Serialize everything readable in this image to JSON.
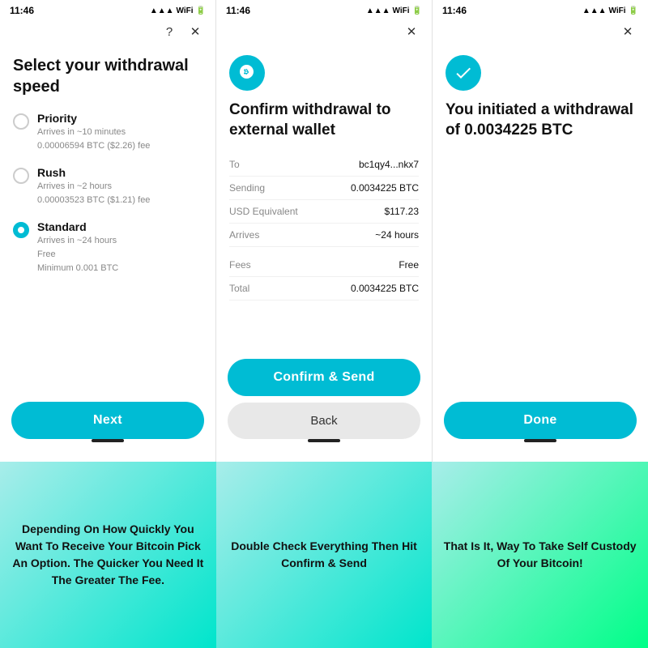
{
  "screens": [
    {
      "status_time": "11:46",
      "title": "Select your withdrawal speed",
      "options": [
        {
          "name": "Priority",
          "desc1": "Arrives in ~10 minutes",
          "desc2": "0.00006594 BTC ($2.26) fee",
          "selected": false
        },
        {
          "name": "Rush",
          "desc1": "Arrives in ~2 hours",
          "desc2": "0.00003523 BTC ($1.21) fee",
          "selected": false
        },
        {
          "name": "Standard",
          "desc1": "Arrives in ~24 hours",
          "desc2": "Free",
          "desc3": "Minimum 0.001 BTC",
          "selected": true
        }
      ],
      "button_label": "Next",
      "has_help": true,
      "has_close": true
    },
    {
      "status_time": "11:46",
      "title": "Confirm withdrawal to external wallet",
      "details": [
        {
          "label": "To",
          "value": "bc1qy4...nkx7"
        },
        {
          "label": "Sending",
          "value": "0.0034225 BTC"
        },
        {
          "label": "USD Equivalent",
          "value": "$117.23"
        },
        {
          "label": "Arrives",
          "value": "~24 hours"
        }
      ],
      "fees": [
        {
          "label": "Fees",
          "value": "Free"
        },
        {
          "label": "Total",
          "value": "0.0034225 BTC"
        }
      ],
      "confirm_button": "Confirm & Send",
      "back_button": "Back",
      "has_close": true
    },
    {
      "status_time": "11:46",
      "title": "You initiated a withdrawal of 0.0034225 BTC",
      "done_button": "Done",
      "has_close": true
    }
  ],
  "captions": [
    "Depending On How Quickly You Want To Receive Your Bitcoin Pick An Option. The Quicker You Need It The Greater The Fee.",
    "Double Check Everything Then Hit Confirm & Send",
    "That Is It, Way To Take Self Custody Of Your Bitcoin!"
  ]
}
